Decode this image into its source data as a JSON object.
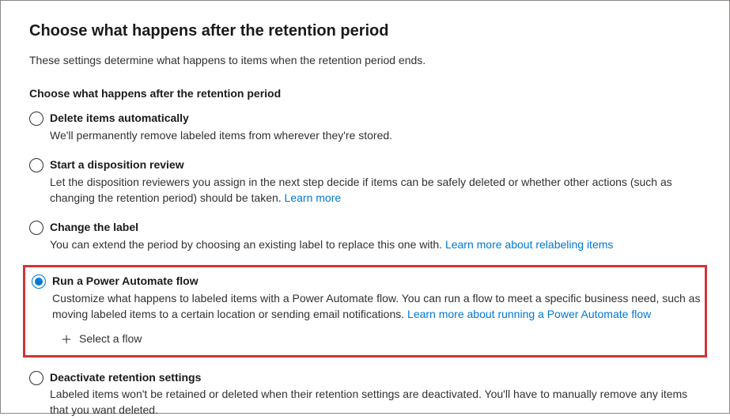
{
  "title": "Choose what happens after the retention period",
  "subtitle": "These settings determine what happens to items when the retention period ends.",
  "section_heading": "Choose what happens after the retention period",
  "options": {
    "delete": {
      "label": "Delete items automatically",
      "desc": "We'll permanently remove labeled items from wherever they're stored."
    },
    "disposition": {
      "label": "Start a disposition review",
      "desc_pre": "Let the disposition reviewers you assign in the next step decide if items can be safely deleted or whether other actions (such as changing the retention period) should be taken.  ",
      "link": "Learn more"
    },
    "change_label": {
      "label": "Change the label",
      "desc_pre": "You can extend the period by choosing an existing label to replace this one with. ",
      "link": "Learn more about relabeling items"
    },
    "power_automate": {
      "label": "Run a Power Automate flow",
      "desc_pre": "Customize what happens to labeled items with a Power Automate flow. You can run a flow to meet a specific business need, such as moving labeled items to a certain location or sending email notifications. ",
      "link": "Learn more about running a Power Automate flow",
      "select_flow": "Select a flow"
    },
    "deactivate": {
      "label": "Deactivate retention settings",
      "desc": "Labeled items won't be retained or deleted when their retention settings are deactivated. You'll have to manually remove any items that you want deleted."
    }
  }
}
